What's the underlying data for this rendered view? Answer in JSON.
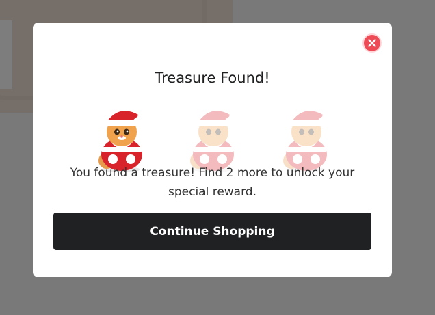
{
  "modal": {
    "title": "Treasure Found!",
    "message": "You found a treasure! Find 2 more to unlock your special reward.",
    "cta_label": "Continue Shopping",
    "close_icon": "close-icon",
    "treasures": [
      {
        "name": "santa-cat-icon",
        "found": true
      },
      {
        "name": "santa-cat-icon",
        "found": false
      },
      {
        "name": "santa-cat-icon",
        "found": false
      }
    ]
  },
  "colors": {
    "button_bg": "#202123",
    "close_bg": "#ee4b57",
    "overlay": "#7b7b7b"
  }
}
